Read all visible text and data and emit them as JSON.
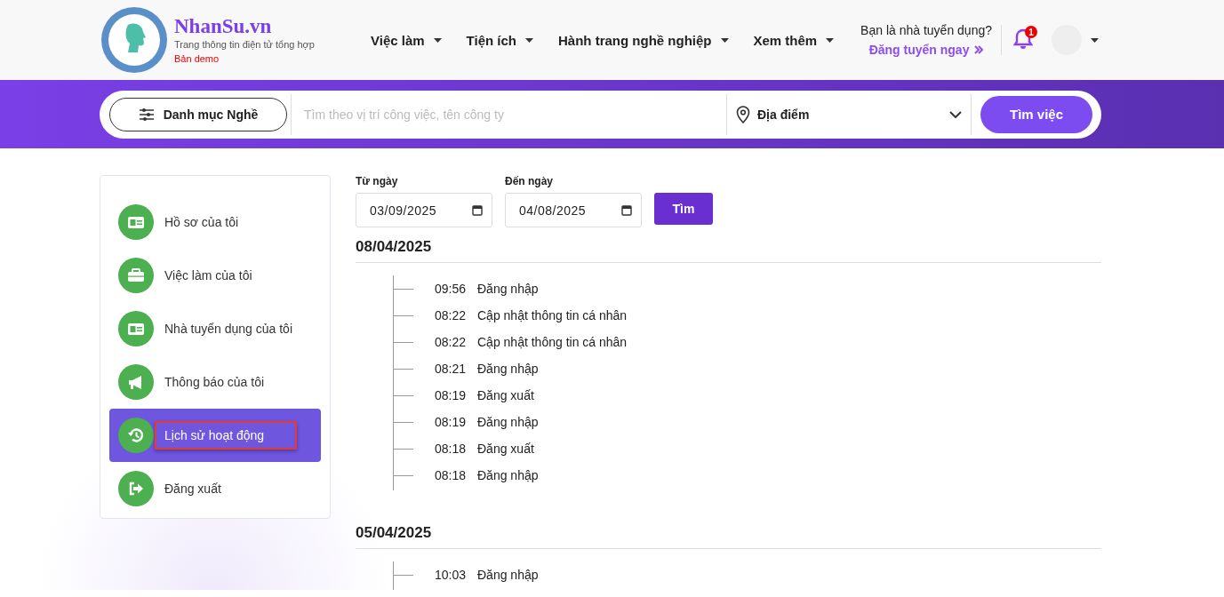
{
  "brand": {
    "name": "NhanSu.vn",
    "tagline": "Trang thông tin điện tử tổng hợp",
    "badge": "Bản demo"
  },
  "nav": [
    {
      "label": "Việc làm"
    },
    {
      "label": "Tiện ích"
    },
    {
      "label": "Hành trang nghề nghiệp"
    },
    {
      "label": "Xem thêm"
    }
  ],
  "employer": {
    "question": "Bạn là nhà tuyển dụng?",
    "link": "Đăng tuyển ngay"
  },
  "notifications": {
    "count": "1"
  },
  "search": {
    "category": "Danh mục Nghề",
    "placeholder": "Tìm theo vị trí công việc, tên công ty",
    "location": "Địa điểm",
    "button": "Tìm việc"
  },
  "sidebar": {
    "items": [
      {
        "label": "Hồ sơ của tôi",
        "kind": "card",
        "selected": false,
        "highlighted": false
      },
      {
        "label": "Việc làm của tôi",
        "kind": "briefcase",
        "selected": false,
        "highlighted": false
      },
      {
        "label": "Nhà tuyển dụng của tôi",
        "kind": "card",
        "selected": false,
        "highlighted": false
      },
      {
        "label": "Thông báo của tôi",
        "kind": "megaphone",
        "selected": false,
        "highlighted": false
      },
      {
        "label": "Lịch sử hoạt động",
        "kind": "history",
        "selected": true,
        "highlighted": true
      },
      {
        "label": "Đăng xuất",
        "kind": "logout",
        "selected": false,
        "highlighted": false
      }
    ]
  },
  "filter": {
    "from_label": "Từ ngày",
    "from_value": "03/09/2025",
    "to_label": "Đến ngày",
    "to_value": "04/08/2025",
    "button": "Tìm"
  },
  "days": [
    {
      "date": "08/04/2025",
      "entries": [
        {
          "time": "09:56",
          "action": "Đăng nhập"
        },
        {
          "time": "08:22",
          "action": "Cập nhật thông tin cá nhân"
        },
        {
          "time": "08:22",
          "action": "Cập nhật thông tin cá nhân"
        },
        {
          "time": "08:21",
          "action": "Đăng nhập"
        },
        {
          "time": "08:19",
          "action": "Đăng xuất"
        },
        {
          "time": "08:19",
          "action": "Đăng nhập"
        },
        {
          "time": "08:18",
          "action": "Đăng xuất"
        },
        {
          "time": "08:18",
          "action": "Đăng nhập"
        }
      ]
    },
    {
      "date": "05/04/2025",
      "entries": [
        {
          "time": "10:03",
          "action": "Đăng nhập"
        }
      ]
    }
  ]
}
